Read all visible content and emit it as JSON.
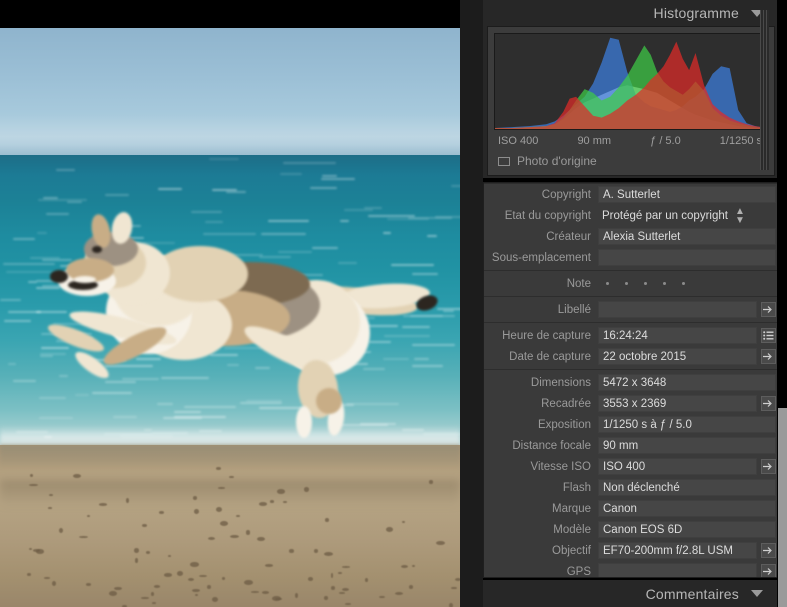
{
  "histogram": {
    "title": "Histogramme",
    "collapse_icon": "chevron-down-icon",
    "stats": {
      "iso": "ISO 400",
      "focal": "90 mm",
      "aperture": "ƒ / 5.0",
      "shutter": "1/1250 s"
    },
    "original_photo_label": "Photo d'origine"
  },
  "chart_data": {
    "type": "area",
    "title": "Histogramme",
    "xlabel": "",
    "ylabel": "",
    "grid": false,
    "legend": "none",
    "xlim": [
      0,
      255
    ],
    "ylim": [
      0,
      100
    ],
    "note": "RGB + luminance tonal distribution overlay, Lightroom style",
    "series": [
      {
        "name": "red",
        "color": "#e02b28",
        "x": [
          0,
          16,
          32,
          48,
          56,
          64,
          70,
          76,
          84,
          92,
          100,
          108,
          116,
          124,
          132,
          140,
          146,
          152,
          158,
          164,
          170,
          176,
          182,
          188,
          196,
          204,
          212,
          220,
          228,
          236,
          244,
          255
        ],
        "values": [
          1,
          1,
          2,
          3,
          6,
          18,
          32,
          34,
          24,
          14,
          12,
          16,
          22,
          30,
          36,
          44,
          52,
          58,
          66,
          78,
          92,
          74,
          62,
          80,
          46,
          26,
          18,
          12,
          8,
          5,
          3,
          1
        ]
      },
      {
        "name": "green",
        "color": "#3fcc46",
        "x": [
          0,
          16,
          32,
          48,
          56,
          64,
          70,
          76,
          84,
          92,
          100,
          108,
          116,
          124,
          132,
          140,
          146,
          152,
          158,
          164,
          170,
          176,
          182,
          188,
          196,
          204,
          212,
          220,
          228,
          236,
          244,
          255
        ],
        "values": [
          1,
          1,
          2,
          3,
          5,
          12,
          20,
          30,
          42,
          38,
          30,
          34,
          44,
          56,
          72,
          88,
          78,
          60,
          50,
          44,
          40,
          36,
          42,
          50,
          40,
          22,
          14,
          9,
          6,
          4,
          2,
          1
        ]
      },
      {
        "name": "blue",
        "color": "#3d7fe0",
        "x": [
          0,
          16,
          32,
          48,
          56,
          64,
          70,
          76,
          84,
          92,
          100,
          108,
          116,
          124,
          132,
          140,
          146,
          152,
          158,
          164,
          170,
          176,
          182,
          188,
          196,
          204,
          212,
          220,
          228,
          236,
          244,
          255
        ],
        "values": [
          1,
          2,
          3,
          5,
          8,
          14,
          20,
          26,
          34,
          48,
          70,
          96,
          94,
          60,
          36,
          28,
          24,
          22,
          20,
          18,
          20,
          24,
          30,
          34,
          42,
          58,
          66,
          64,
          20,
          6,
          3,
          1
        ]
      },
      {
        "name": "luminance",
        "color": "#d6d6d6",
        "x": [
          0,
          16,
          32,
          48,
          56,
          64,
          70,
          76,
          84,
          92,
          100,
          108,
          116,
          124,
          132,
          140,
          146,
          152,
          158,
          164,
          170,
          176,
          182,
          188,
          196,
          204,
          212,
          220,
          228,
          236,
          244,
          255
        ],
        "values": [
          1,
          1,
          2,
          3,
          5,
          10,
          16,
          22,
          28,
          32,
          36,
          40,
          44,
          46,
          44,
          42,
          40,
          38,
          34,
          30,
          26,
          22,
          18,
          15,
          12,
          9,
          7,
          5,
          3,
          2,
          1,
          1
        ]
      }
    ]
  },
  "metadata": {
    "rows": [
      {
        "label": "Copyright",
        "value": "A. Sutterlet",
        "style": "field",
        "button": "none"
      },
      {
        "label": "Etat du copyright",
        "value": "Protégé par un copyright",
        "style": "plain",
        "button": "stepper"
      },
      {
        "label": "Créateur",
        "value": "Alexia Sutterlet",
        "style": "field",
        "button": "none"
      },
      {
        "label": "Sous-emplacement",
        "value": "",
        "style": "field",
        "button": "none"
      }
    ],
    "rating": {
      "label": "Note",
      "value": 0,
      "max": 5
    },
    "label_row": {
      "label": "Libellé",
      "value": "",
      "button": "arrow"
    },
    "capture": [
      {
        "label": "Heure de capture",
        "value": "16:24:24",
        "button": "list"
      },
      {
        "label": "Date de capture",
        "value": "22 octobre 2015",
        "button": "arrow"
      }
    ],
    "exif": [
      {
        "label": "Dimensions",
        "value": "5472 x 3648",
        "button": "none"
      },
      {
        "label": "Recadrée",
        "value": "3553 x 2369",
        "button": "arrow"
      },
      {
        "label": "Exposition",
        "value": "1/1250 s à ƒ / 5.0",
        "button": "none"
      },
      {
        "label": "Distance focale",
        "value": "90 mm",
        "button": "none"
      },
      {
        "label": "Vitesse ISO",
        "value": "ISO 400",
        "button": "arrow"
      },
      {
        "label": "Flash",
        "value": "Non déclenché",
        "button": "none"
      },
      {
        "label": "Marque",
        "value": "Canon",
        "button": "none"
      },
      {
        "label": "Modèle",
        "value": "Canon EOS 6D",
        "button": "none"
      },
      {
        "label": "Objectif",
        "value": "EF70-200mm f/2.8L USM",
        "button": "arrow"
      },
      {
        "label": "GPS",
        "value": "",
        "button": "arrow",
        "style": "field"
      }
    ]
  },
  "comments": {
    "title": "Commentaires",
    "collapse_icon": "chevron-down-icon"
  },
  "photo": {
    "alt": "Czechoslovakian wolfdog running on a beach by the sea"
  },
  "colors": {
    "panel_bg": "#3a3a3a",
    "header_bg": "#272727",
    "text": "#dcdcdc",
    "label": "#9a9a9a"
  }
}
